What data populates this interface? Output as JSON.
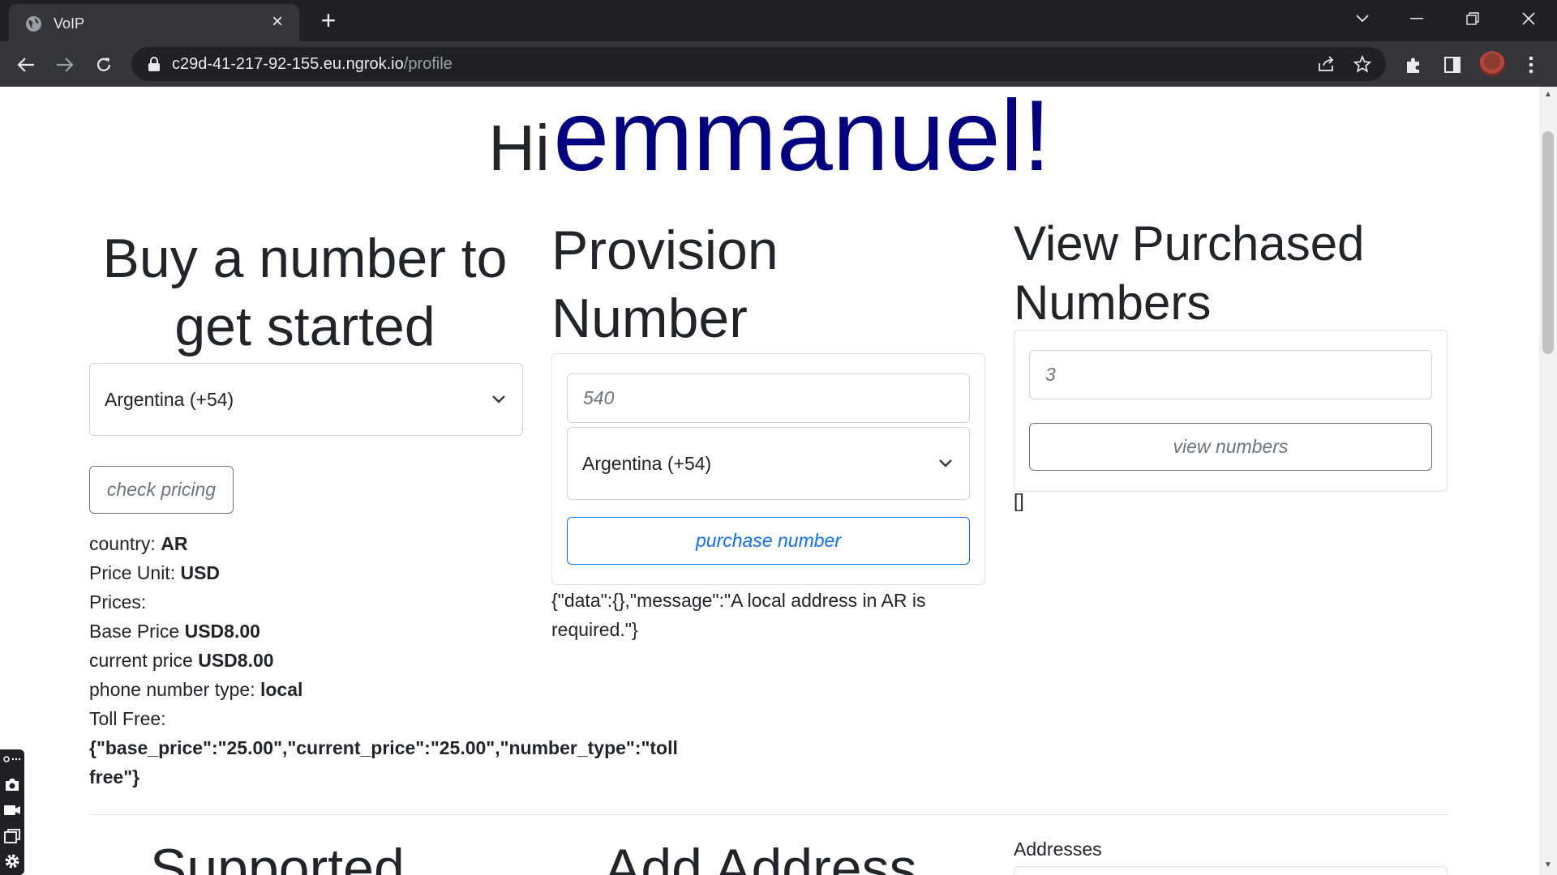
{
  "browser": {
    "tab_title": "VoIP",
    "url_host": "c29d-41-217-92-155.eu.ngrok.io",
    "url_path": "/profile"
  },
  "greeting": {
    "prefix": "Hi",
    "name": "emmanuel!"
  },
  "buy": {
    "heading": "Buy a number to get started",
    "country_selected": "Argentina (+54)",
    "check_pricing_label": "check pricing",
    "country_label": "country:",
    "country_value": "AR",
    "price_unit_label": "Price Unit:",
    "price_unit_value": "USD",
    "prices_label": "Prices:",
    "base_price_label": "Base Price",
    "base_price_value": "USD8.00",
    "current_price_label": "current price",
    "current_price_value": "USD8.00",
    "number_type_label": "phone number type:",
    "number_type_value": "local",
    "toll_free_label": "Toll Free:",
    "toll_free_value": "{\"base_price\":\"25.00\",\"current_price\":\"25.00\",\"number_type\":\"toll free\"}"
  },
  "provision": {
    "heading": "Provision Number",
    "area_code_placeholder": "540",
    "country_selected": "Argentina (+54)",
    "purchase_label": "purchase number",
    "response": "{\"data\":{},\"message\":\"A local address in AR is required.\"}"
  },
  "purchased": {
    "heading": "View Purchased Numbers",
    "input_placeholder": "3",
    "view_label": "view numbers",
    "result": "[]"
  },
  "bottom": {
    "supported_heading": "Supported",
    "add_address_heading": "Add Address",
    "addresses_label": "Addresses"
  },
  "colors": {
    "name": "#000080",
    "primary": "#0d6efd",
    "chrome_dark": "#202124",
    "chrome_toolbar": "#35363a"
  }
}
